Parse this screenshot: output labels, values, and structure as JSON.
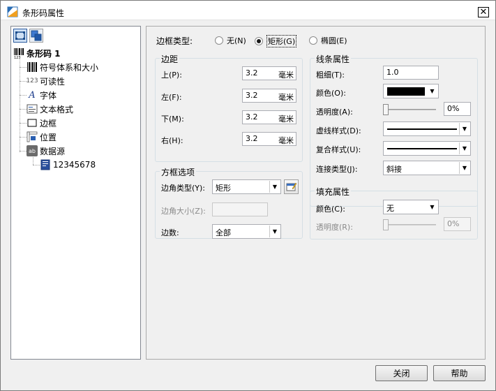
{
  "window": {
    "title": "条形码属性",
    "close_glyph": "✕"
  },
  "tree": {
    "toolbar": [
      {
        "icon": "tree-view-icon"
      },
      {
        "icon": "layers-icon"
      }
    ],
    "root": {
      "label": "条形码 1",
      "icon": "barcode-icon",
      "icon_text": "123"
    },
    "items": [
      {
        "label": "符号体系和大小",
        "icon": "barcode-symbology-icon"
      },
      {
        "label": "可读性",
        "icon": "readable-text-icon",
        "icon_text": "123"
      },
      {
        "label": "字体",
        "icon": "font-icon",
        "icon_text": "A"
      },
      {
        "label": "文本格式",
        "icon": "text-format-icon"
      },
      {
        "label": "边框",
        "icon": "border-icon"
      },
      {
        "label": "位置",
        "icon": "position-icon"
      },
      {
        "label": "数据源",
        "icon": "datasource-icon",
        "icon_text": "ab"
      }
    ],
    "datasource_child": {
      "label": "12345678",
      "icon": "data-field-icon"
    }
  },
  "border_type": {
    "label": "边框类型:",
    "options": [
      "无(N)",
      "矩形(G)",
      "椭圆(E)"
    ],
    "selected": "矩形(G)"
  },
  "margin": {
    "title": "边距",
    "fields": [
      {
        "label": "上(P):",
        "value": "3.2",
        "unit": "毫米"
      },
      {
        "label": "左(F):",
        "value": "3.2",
        "unit": "毫米"
      },
      {
        "label": "下(M):",
        "value": "3.2",
        "unit": "毫米"
      },
      {
        "label": "右(H):",
        "value": "3.2",
        "unit": "毫米"
      }
    ]
  },
  "box_options": {
    "title": "方框选项",
    "corner_type_label": "边角类型(Y):",
    "corner_type_value": "矩形",
    "corner_size_label": "边角大小(Z):",
    "corner_size_value": "",
    "sides_label": "边数:",
    "sides_value": "全部"
  },
  "line_props": {
    "title": "线条属性",
    "thickness_label": "粗细(T):",
    "thickness_value": "1.0",
    "color_label": "颜色(O):",
    "color_value": "#000000",
    "transparency_label": "透明度(A):",
    "transparency_value": "0%",
    "transparency_level": 0,
    "dash_label": "虚线样式(D):",
    "compound_label": "复合样式(U):",
    "join_label": "连接类型(J):",
    "join_value": "斜接"
  },
  "fill_props": {
    "title": "填充属性",
    "color_label": "颜色(C):",
    "color_value": "无",
    "transparency_label": "透明度(R):",
    "transparency_value": "0%",
    "transparency_level": 0
  },
  "buttons": {
    "close": "关闭",
    "help": "帮助"
  }
}
